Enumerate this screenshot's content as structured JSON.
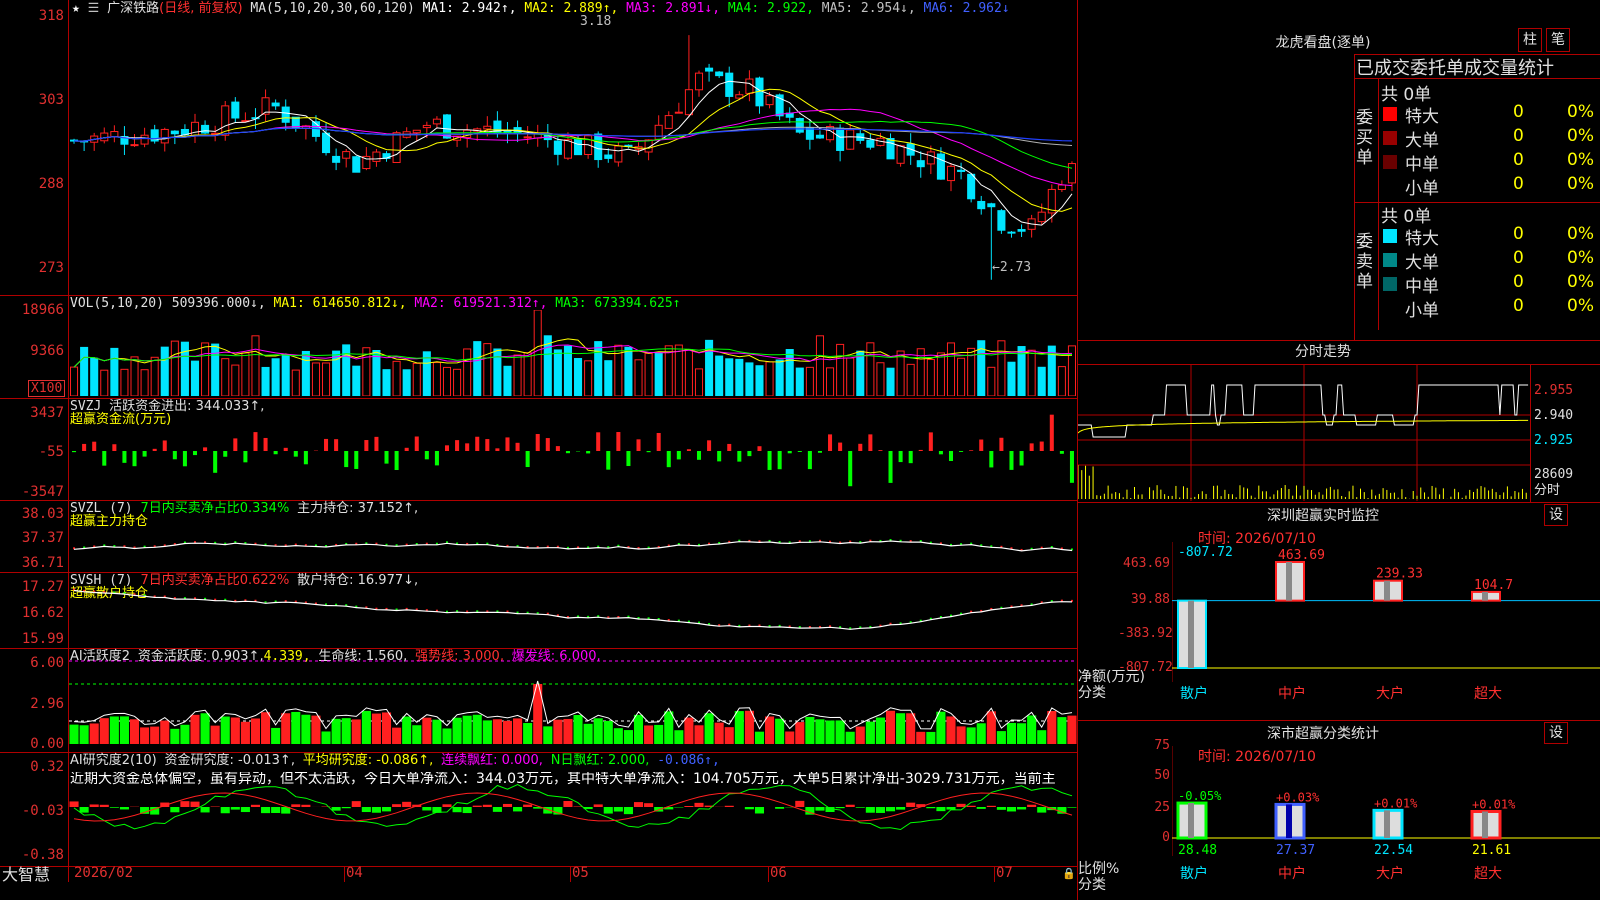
{
  "colors": {
    "up": "#ff2020",
    "down": "#00e5ff",
    "grid": "#b00000",
    "ma1": "#ffffff",
    "ma2": "#ffff00",
    "ma3": "#ff00ff",
    "ma4": "#00ff00",
    "ma5": "#b0b0b0",
    "ma6": "#2040ff"
  },
  "main": {
    "stock_name": "广深铁路",
    "period": "(日线, 前复权)",
    "ma_params": "MA(5,10,20,30,60,120)",
    "ma1": "MA1: 2.942↑,",
    "ma2": "MA2: 2.889↑,",
    "ma3": "MA3: 2.891↓,",
    "ma4": "MA4: 2.922,",
    "ma5": "MA5: 2.954↓,",
    "ma6": "MA6: 2.962↓",
    "y_ticks": [
      "318",
      "303",
      "288",
      "273"
    ],
    "high_label": "3.18",
    "low_label": "←2.73"
  },
  "vol": {
    "title": "VOL(5,10,20)",
    "value": "509396.000↓,",
    "ma1": "MA1: 614650.812↓,",
    "ma2": "MA2: 619521.312↑,",
    "ma3": "MA3: 673394.625↑",
    "y_ticks": [
      "18966",
      "9366"
    ],
    "unit": "X100"
  },
  "svzj": {
    "title": "SVZJ",
    "text": "活跃资金进出: 344.033↑,",
    "sub": "超赢资金流(万元)",
    "y_ticks": [
      "3437",
      "-55",
      "-3547"
    ]
  },
  "svzl": {
    "title": "SVZL (7)",
    "text1": "7日内买卖净占比0.334%",
    "text2": "主力持仓: 37.152↑,",
    "sub": "超赢主力持仓",
    "y_ticks": [
      "38.03",
      "37.37",
      "36.71"
    ]
  },
  "svsh": {
    "title": "SVSH (7)",
    "text1": "7日内买卖净占比0.622%",
    "text2": "散户持仓: 16.977↓,",
    "sub": "超赢散户持仓",
    "y_ticks": [
      "17.27",
      "16.62",
      "15.99"
    ]
  },
  "ai1": {
    "title": "AI活跃度2",
    "t1": "资金活跃度: 0.903↑,",
    "t2": "4.339,",
    "t3": "生命线: 1.560,",
    "t4": "强势线: 3.000,",
    "t5": "爆发线: 6.000,",
    "y_ticks": [
      "6.00",
      "2.96",
      "0.00"
    ]
  },
  "ai2": {
    "title": "AI研究度2(10)",
    "t1": "资金研究度: -0.013↑,",
    "t2": "平均研究度: -0.086↑,",
    "t3": "连续飘红: 0.000,",
    "t4": "N日飘红: 2.000,",
    "t5": "-0.086↑,",
    "summary": "近期大资金总体偏空，虽有异动，但不太活跃，今日大单净流入：344.03万元，其中特大单净流入：104.705万元，大单5日累计净出-3029.731万元，当前主",
    "y_ticks": [
      "0.32",
      "-0.03",
      "-0.38"
    ]
  },
  "xaxis": {
    "labels": [
      "2026/02",
      "04",
      "05",
      "06",
      "07"
    ],
    "brand": "大智慧"
  },
  "lhb": {
    "title": "龙虎看盘(逐单)",
    "btn_zhu": "柱",
    "btn_bi": "笔",
    "header": "已成交委托单成交量统计",
    "buy_label": "委买单",
    "sell_label": "委卖单",
    "buy_total": "共 0单",
    "sell_total": "共 0单",
    "rows": [
      {
        "name": "特大",
        "val": "0",
        "pct": "0%",
        "color": "#ff0000"
      },
      {
        "name": "大单",
        "val": "0",
        "pct": "0%",
        "color": "#990000"
      },
      {
        "name": "中单",
        "val": "0",
        "pct": "0%",
        "color": "#6a0000"
      },
      {
        "name": "小单",
        "val": "0",
        "pct": "0%",
        "color": "#000000"
      }
    ],
    "sell_rows": [
      {
        "name": "特大",
        "val": "0",
        "pct": "0%",
        "color": "#00e5ff"
      },
      {
        "name": "大单",
        "val": "0",
        "pct": "0%",
        "color": "#008888"
      },
      {
        "name": "中单",
        "val": "0",
        "pct": "0%",
        "color": "#006666"
      },
      {
        "name": "小单",
        "val": "0",
        "pct": "0%",
        "color": "#000000"
      }
    ]
  },
  "fenshi": {
    "title": "分时走势",
    "prices": [
      "2.955",
      "2.940",
      "2.925"
    ],
    "vol_label": "28609",
    "vol_sub": "分时"
  },
  "monitor": {
    "title": "深圳超赢实时监控",
    "btn": "设",
    "time": "时间: 2026/07/10",
    "y_ticks": [
      "463.69",
      "39.88",
      "-383.92",
      "-807.72"
    ],
    "ylabel": "净额(万元)",
    "xlabel": "分类",
    "cats": [
      "散户",
      "中户",
      "大户",
      "超大"
    ],
    "values": [
      -807.72,
      463.69,
      239.33,
      104.7
    ],
    "value_labels": [
      "-807.72",
      "463.69",
      "239.33",
      "104.7"
    ]
  },
  "stats": {
    "title": "深市超赢分类统计",
    "btn": "设",
    "time": "时间: 2026/07/10",
    "y_ticks": [
      "75",
      "50",
      "25",
      "0"
    ],
    "ylabel": "比例%",
    "xlabel": "分类",
    "cats": [
      "散户",
      "中户",
      "大户",
      "超大"
    ],
    "values": [
      28.48,
      27.37,
      22.54,
      21.61
    ],
    "value_labels": [
      "28.48",
      "27.37",
      "22.54",
      "21.61"
    ],
    "change_labels": [
      "-0.05%",
      "+0.03%",
      "+0.01%",
      "+0.01%"
    ]
  }
}
